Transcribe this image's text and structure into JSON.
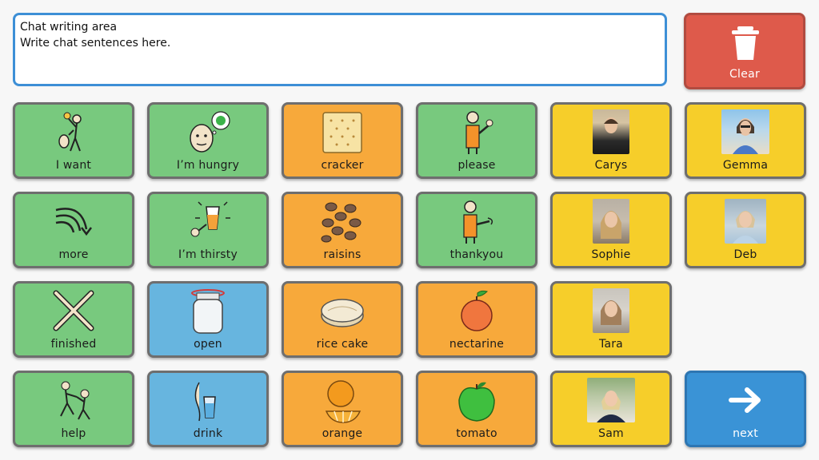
{
  "chat": {
    "line1": "Chat writing area",
    "line2": "Write chat sentences here."
  },
  "clear": {
    "label": "Clear",
    "icon": "trash-icon",
    "color": "#de5a4b"
  },
  "colors": {
    "verbs": "#78c97e",
    "nouns": "#f7a93b",
    "people": "#f6ce2a",
    "actions": "#67b5df",
    "next": "#3a93d6"
  },
  "tiles": {
    "i_want": "I want",
    "im_hungry": "I’m hungry",
    "cracker": "cracker",
    "please": "please",
    "carys": "Carys",
    "gemma": "Gemma",
    "more": "more",
    "im_thirsty": "I’m thirsty",
    "raisins": "raisins",
    "thankyou": "thankyou",
    "sophie": "Sophie",
    "deb": "Deb",
    "finished": "finished",
    "open": "open",
    "rice_cake": "rice cake",
    "nectarine": "nectarine",
    "tara": "Tara",
    "help": "help",
    "drink": "drink",
    "orange": "orange",
    "tomato": "tomato",
    "sam": "Sam",
    "next": "next"
  }
}
